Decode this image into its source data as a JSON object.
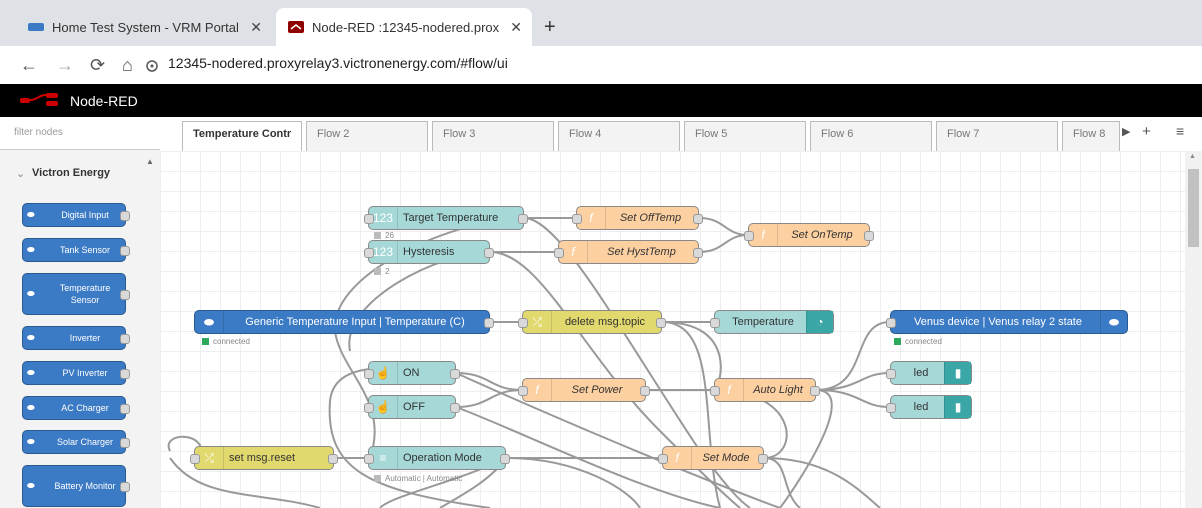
{
  "browser": {
    "tabs": [
      {
        "title": "Home Test System - VRM Portal"
      },
      {
        "title": "Node-RED :12345-nodered.prox"
      }
    ],
    "url": "12345-nodered.proxyrelay3.victronenergy.com/#flow/ui"
  },
  "app": {
    "title": "Node-RED"
  },
  "palette": {
    "filter_placeholder": "filter nodes",
    "category": "Victron Energy",
    "items": [
      "Digital Input",
      "Tank Sensor",
      "Temperature Sensor",
      "Inverter",
      "PV Inverter",
      "AC Charger",
      "Solar Charger",
      "Battery Monitor"
    ]
  },
  "flow_tabs": [
    "Temperature Contr",
    "Flow 2",
    "Flow 3",
    "Flow 4",
    "Flow 5",
    "Flow 6",
    "Flow 7",
    "Flow 8"
  ],
  "nodes": {
    "target_temp": {
      "label": "Target Temperature",
      "status": "26"
    },
    "hysteresis": {
      "label": "Hysteresis",
      "status": "2"
    },
    "set_offtemp": {
      "label": "Set OffTemp"
    },
    "set_hysttemp": {
      "label": "Set HystTemp"
    },
    "set_ontemp": {
      "label": "Set OnTemp"
    },
    "generic_temp": {
      "label": "Generic Temperature Input | Temperature (C)",
      "status": "connected"
    },
    "delete_topic": {
      "label": "delete msg.topic"
    },
    "temperature": {
      "label": "Temperature"
    },
    "venus_relay": {
      "label": "Venus device | Venus relay 2 state",
      "status": "connected"
    },
    "on": {
      "label": "ON"
    },
    "off": {
      "label": "OFF"
    },
    "set_power": {
      "label": "Set Power"
    },
    "auto_light": {
      "label": "Auto Light"
    },
    "led1": {
      "label": "led"
    },
    "led2": {
      "label": "led"
    },
    "set_reset": {
      "label": "set msg.reset"
    },
    "op_mode": {
      "label": "Operation Mode",
      "status": "Automatic | Automatic"
    },
    "set_mode": {
      "label": "Set Mode"
    }
  },
  "colors": {
    "inject": "#a6d8d8",
    "function": "#fdd0a2",
    "change": "#e2d96e",
    "victron": "#3b7ac4",
    "ui": "#3aa6a6",
    "connected": "#2ea85a"
  }
}
